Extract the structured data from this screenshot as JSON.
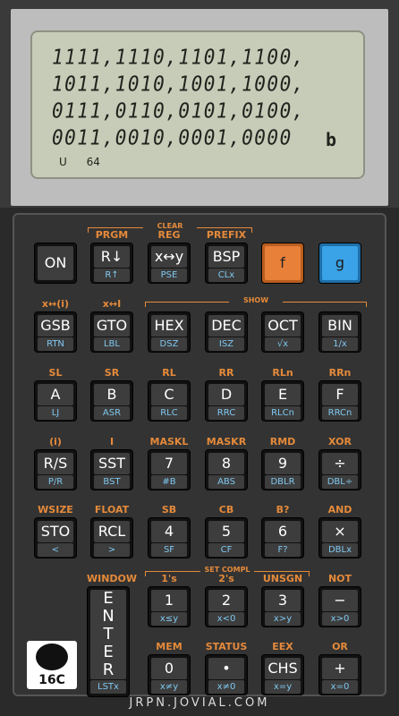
{
  "display": {
    "rows": [
      "1111,1110,1101,1100,",
      "1011,1010,1001,1000,",
      "0111,0110,0101,0100,",
      "0011,0010,0001,0000"
    ],
    "suffix": "b",
    "annunciators": [
      "U",
      "64"
    ]
  },
  "brackets": {
    "clear": "CLEAR",
    "show": "SHOW",
    "set_compl": "SET COMPL"
  },
  "keys": [
    {
      "id": "on",
      "label": "ON"
    },
    {
      "id": "rdown",
      "label": "R↓",
      "g": "R↑",
      "f": "PRGM"
    },
    {
      "id": "xy",
      "label": "x↔y",
      "g": "PSE",
      "f": "REG"
    },
    {
      "id": "bsp",
      "label": "BSP",
      "g": "CLx",
      "f": "PREFIX"
    },
    {
      "id": "f",
      "label": "f"
    },
    {
      "id": "g",
      "label": "g"
    },
    {
      "id": "gsb",
      "label": "GSB",
      "g": "RTN",
      "f": "x↔(i)"
    },
    {
      "id": "gto",
      "label": "GTO",
      "g": "LBL",
      "f": "x↔I"
    },
    {
      "id": "hex",
      "label": "HEX",
      "g": "DSZ"
    },
    {
      "id": "dec",
      "label": "DEC",
      "g": "ISZ"
    },
    {
      "id": "oct",
      "label": "OCT",
      "g": "√x"
    },
    {
      "id": "bin",
      "label": "BIN",
      "g": "1/x"
    },
    {
      "id": "a",
      "label": "A",
      "g": "LJ",
      "f": "SL"
    },
    {
      "id": "b",
      "label": "B",
      "g": "ASR",
      "f": "SR"
    },
    {
      "id": "c",
      "label": "C",
      "g": "RLC",
      "f": "RL"
    },
    {
      "id": "d",
      "label": "D",
      "g": "RRC",
      "f": "RR"
    },
    {
      "id": "e",
      "label": "E",
      "g": "RLCn",
      "f": "RLn"
    },
    {
      "id": "fkey",
      "label": "F",
      "g": "RRCn",
      "f": "RRn"
    },
    {
      "id": "rs",
      "label": "R/S",
      "g": "P/R",
      "f": "(i)"
    },
    {
      "id": "sst",
      "label": "SST",
      "g": "BST",
      "f": "I"
    },
    {
      "id": "k7",
      "label": "7",
      "g": "#B",
      "f": "MASKL"
    },
    {
      "id": "k8",
      "label": "8",
      "g": "ABS",
      "f": "MASKR"
    },
    {
      "id": "k9",
      "label": "9",
      "g": "DBLR",
      "f": "RMD"
    },
    {
      "id": "div",
      "label": "÷",
      "g": "DBL÷",
      "f": "XOR"
    },
    {
      "id": "sto",
      "label": "STO",
      "g": "<",
      "f": "WSIZE"
    },
    {
      "id": "rcl",
      "label": "RCL",
      "g": ">",
      "f": "FLOAT"
    },
    {
      "id": "k4",
      "label": "4",
      "g": "SF",
      "f": "SB"
    },
    {
      "id": "k5",
      "label": "5",
      "g": "CF",
      "f": "CB"
    },
    {
      "id": "k6",
      "label": "6",
      "g": "F?",
      "f": "B?"
    },
    {
      "id": "mul",
      "label": "×",
      "g": "DBLx",
      "f": "AND"
    },
    {
      "id": "enter",
      "label": "ENTER",
      "g": "LSTx",
      "f": "WINDOW"
    },
    {
      "id": "k1",
      "label": "1",
      "g": "x≤y",
      "f": "1's"
    },
    {
      "id": "k2",
      "label": "2",
      "g": "x<0",
      "f": "2's"
    },
    {
      "id": "k3",
      "label": "3",
      "g": "x>y",
      "f": "UNSGN"
    },
    {
      "id": "sub",
      "label": "−",
      "g": "x>0",
      "f": "NOT"
    },
    {
      "id": "k0",
      "label": "0",
      "g": "x≠y",
      "f": "MEM"
    },
    {
      "id": "dot",
      "label": "•",
      "g": "x≠0",
      "f": "STATUS"
    },
    {
      "id": "chs",
      "label": "CHS",
      "g": "x=y",
      "f": "EEX"
    },
    {
      "id": "add",
      "label": "+",
      "g": "x=0",
      "f": "OR"
    }
  ],
  "logo": {
    "text": "16C"
  },
  "footer": "JRPN.JOVIAL.COM",
  "colors": {
    "f_accent": "#e8803a",
    "g_accent": "#3aa2e6",
    "g_label": "#7fc8f0"
  }
}
